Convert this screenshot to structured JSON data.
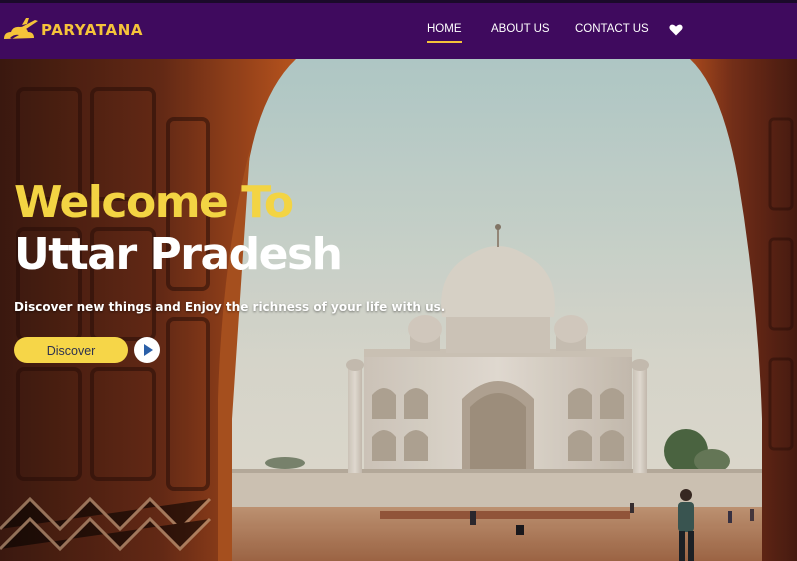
{
  "brand": {
    "name": "PARYATANA",
    "logo_icon": "plane-cloud-icon"
  },
  "nav": {
    "items": [
      {
        "label": "HOME",
        "active": true
      },
      {
        "label": "ABOUT US",
        "active": false
      },
      {
        "label": "CONTACT US",
        "active": false
      }
    ],
    "heart_icon": "heart-icon"
  },
  "hero": {
    "title_line1": "Welcome To",
    "title_line2": "Uttar Pradesh",
    "subtitle": "Discover new things and Enjoy the richness of your life with us.",
    "discover_label": "Discover",
    "play_icon": "play-icon"
  },
  "colors": {
    "nav_bg": "#3f0a5e",
    "accent_yellow": "#f5c33a",
    "button_yellow": "#f6d648",
    "play_blue": "#2a5fa8"
  }
}
